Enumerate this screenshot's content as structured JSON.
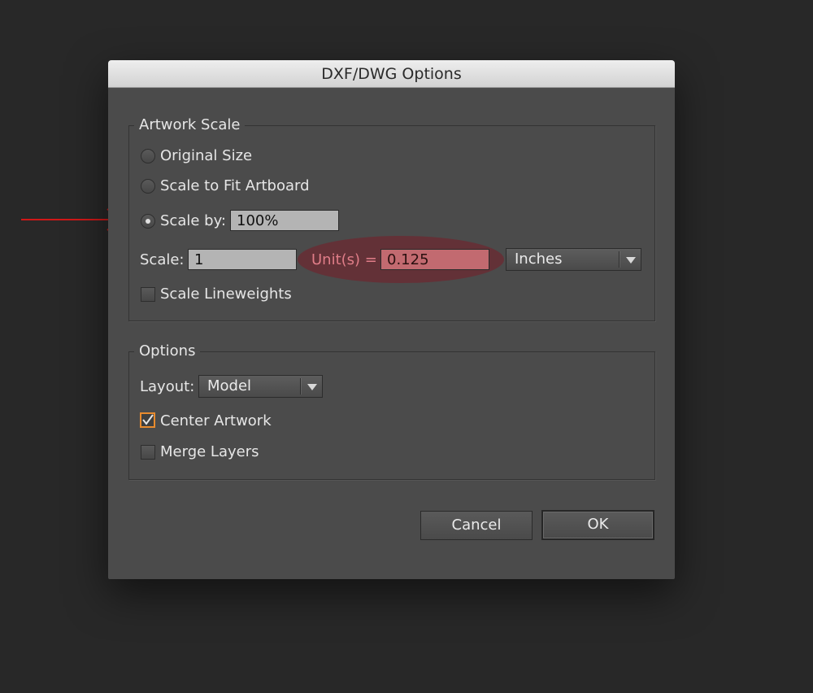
{
  "dialog": {
    "title": "DXF/DWG Options"
  },
  "artwork_scale": {
    "legend": "Artwork Scale",
    "radio_original": "Original Size",
    "radio_fit": "Scale to Fit Artboard",
    "radio_scale_by": "Scale by:",
    "scale_by_value": "100%",
    "scale_label": "Scale:",
    "scale_value": "1",
    "units_label": "Unit(s) =",
    "units_value": "0.125",
    "unit_select": "Inches",
    "scale_lineweights": "Scale Lineweights"
  },
  "options": {
    "legend": "Options",
    "layout_label": "Layout:",
    "layout_value": "Model",
    "center_artwork": "Center Artwork",
    "merge_layers": "Merge Layers"
  },
  "buttons": {
    "cancel": "Cancel",
    "ok": "OK"
  },
  "colors": {
    "background": "#282828",
    "dialog": "#4b4b4b",
    "highlight_field": "#c26a70",
    "highlight_ellipse": "#782838",
    "annotation_arrow": "#d01818",
    "checkbox_accent": "#e88b2e"
  },
  "icons": {
    "annotation": "red-arrow-icon",
    "dropdown": "chevron-down-icon",
    "check": "checkmark-icon"
  }
}
